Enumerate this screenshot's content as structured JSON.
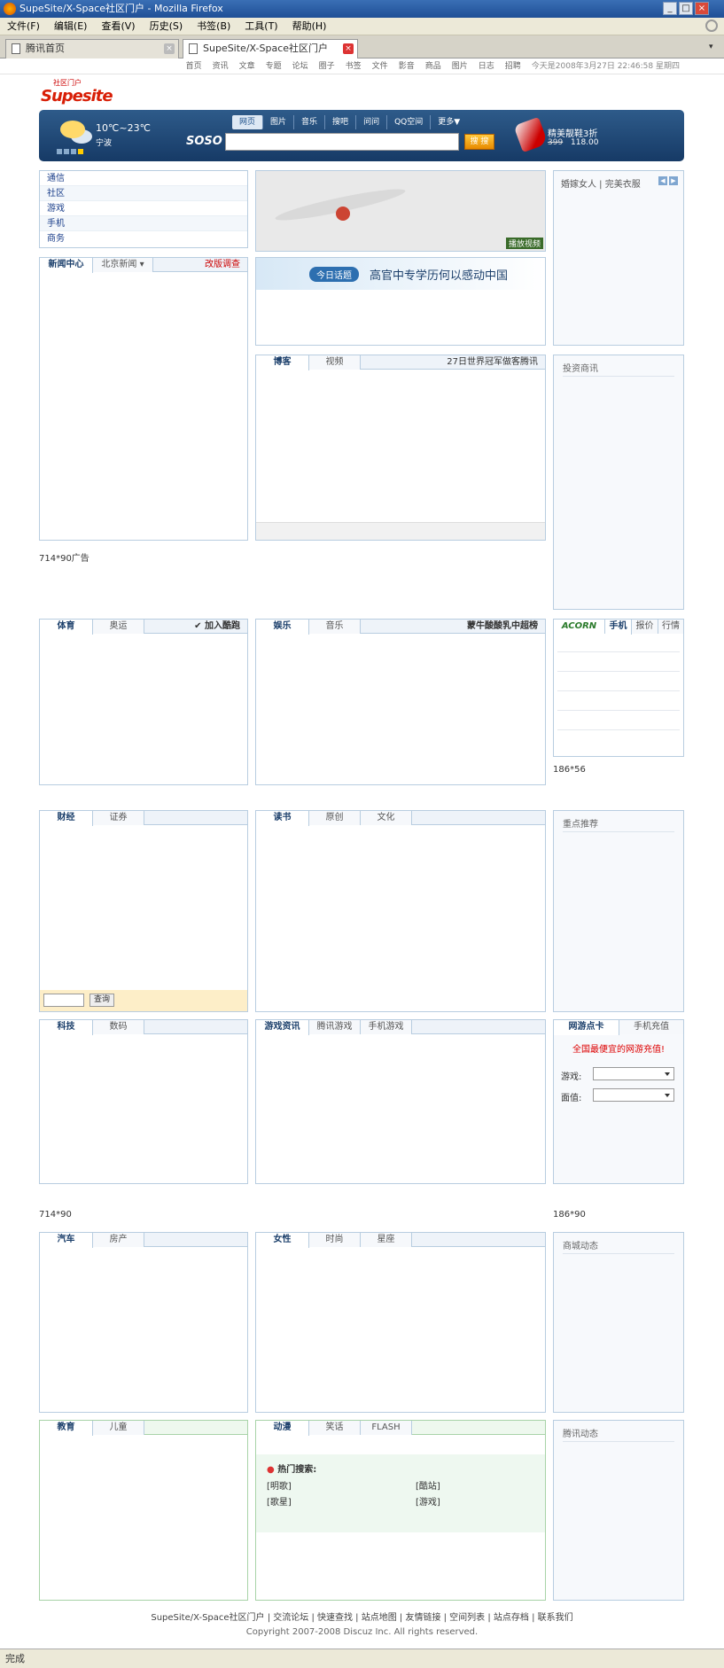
{
  "window": {
    "title": "SupeSite/X-Space社区门户 - Mozilla Firefox"
  },
  "menu": [
    "文件(F)",
    "编辑(E)",
    "查看(V)",
    "历史(S)",
    "书签(B)",
    "工具(T)",
    "帮助(H)"
  ],
  "tabs": [
    {
      "label": "腾讯首页"
    },
    {
      "label": "SupeSite/X-Space社区门户"
    }
  ],
  "topnav": {
    "items": [
      "首页",
      "资讯",
      "文章",
      "专题",
      "论坛",
      "圈子",
      "书签",
      "文件",
      "影音",
      "商品",
      "图片",
      "日志",
      "招聘"
    ],
    "date": "今天是2008年3月27日 22:46:58 星期四"
  },
  "logo": {
    "small": "社区门户",
    "main": "Supesite"
  },
  "banner": {
    "temp": "10℃~23℃",
    "city": "宁波",
    "soso": "SOSO",
    "search_tabs": [
      "网页",
      "图片",
      "音乐",
      "搜吧",
      "问问",
      "QQ空间",
      "更多▼"
    ],
    "search_button": "搜 搜",
    "promo": "精美靓鞋3折",
    "promo_old": "399",
    "promo_new": "118.00"
  },
  "links": [
    "通信",
    "社区",
    "游戏",
    "手机",
    "商务"
  ],
  "news": {
    "tab1": "新闻中心",
    "tab2": "北京新闻 ▾",
    "survey": "改版调查"
  },
  "photo": {
    "caption": "播放视频"
  },
  "today": {
    "badge": "今日话题",
    "title": "高官中专学历何以感动中国"
  },
  "blog": {
    "tabs": [
      "博客",
      "视频"
    ],
    "headline": "27日世界冠军做客腾讯"
  },
  "ad1": "714*90广告",
  "ad2": "714*90",
  "ad3": "186*56",
  "ad4": "186*90",
  "right1": {
    "title": "婚嫁女人 | 完美衣服"
  },
  "right2": {
    "title": "投资商讯"
  },
  "sports": {
    "tabs": [
      "体育",
      "奥运"
    ],
    "nike": "加入酷跑"
  },
  "ent": {
    "tabs": [
      "娱乐",
      "音乐"
    ],
    "sponsor": "蒙牛酸酸乳中超榜"
  },
  "acorn": {
    "brand": "ACORN",
    "tabs": [
      "手机",
      "报价",
      "行情"
    ]
  },
  "finance": {
    "tabs": [
      "财经",
      "证券"
    ],
    "query": "查询"
  },
  "books": {
    "tabs": [
      "读书",
      "原创",
      "文化"
    ]
  },
  "recommend": {
    "title": "重点推荐"
  },
  "tech": {
    "tabs": [
      "科技",
      "数码"
    ]
  },
  "games": {
    "tabs": [
      "游戏资讯",
      "腾讯游戏",
      "手机游戏"
    ]
  },
  "card": {
    "tabs": [
      "网游点卡",
      "手机充值"
    ],
    "slogan": "全国最便宜的网游充值!",
    "game_label": "游戏:",
    "value_label": "面值:"
  },
  "auto": {
    "tabs": [
      "汽车",
      "房产"
    ]
  },
  "female": {
    "tabs": [
      "女性",
      "时尚",
      "星座"
    ]
  },
  "business": {
    "title": "商城动态"
  },
  "edu": {
    "tabs": [
      "教育",
      "儿童"
    ]
  },
  "comic": {
    "tabs": [
      "动漫",
      "笑话",
      "FLASH"
    ],
    "hot": "热门搜索:",
    "links": [
      "[明歌]",
      "[酷站]",
      "[歌星]",
      "[游戏]"
    ]
  },
  "qqnews": {
    "title": "腾讯动态"
  },
  "footer": {
    "links": "SupeSite/X-Space社区门户 | 交流论坛 | 快速查找 | 站点地图 | 友情链接 | 空间列表 | 站点存档 | 联系我们",
    "copyright": "Copyright 2007-2008 Discuz Inc. All rights reserved."
  },
  "status": "完成"
}
